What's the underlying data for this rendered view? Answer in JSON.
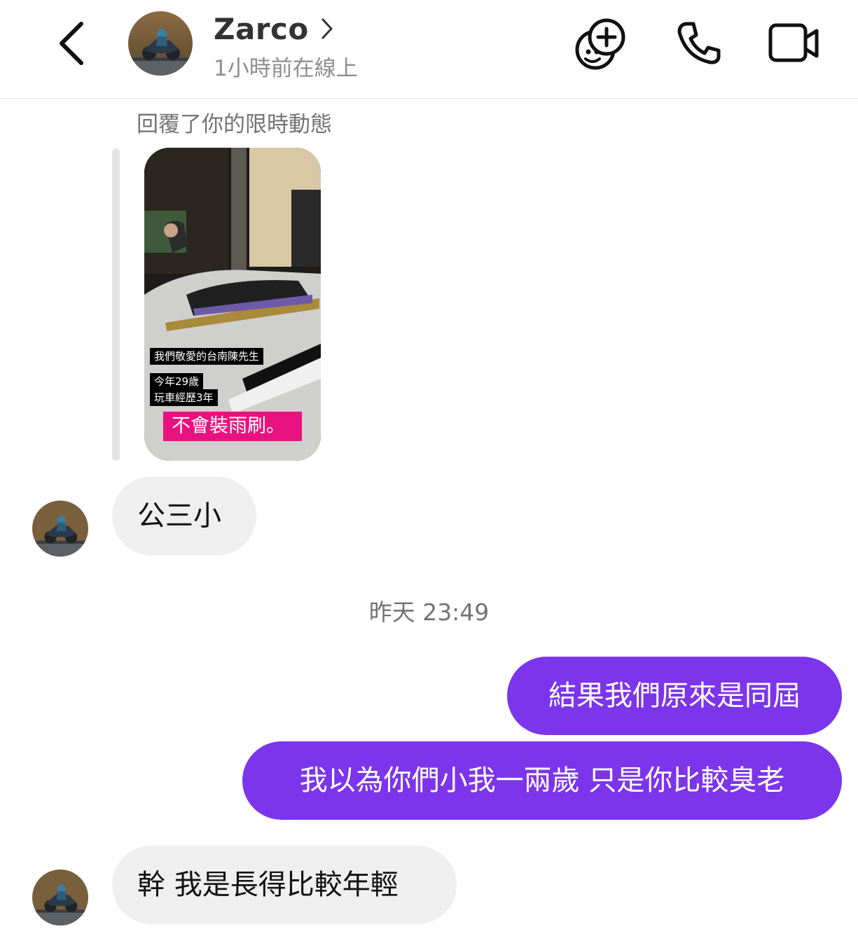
{
  "header": {
    "contact_name": "Zarco",
    "status": "1小時前在線上",
    "icons": [
      "back-chevron-icon",
      "chevron-right-icon",
      "game-controller-icon",
      "phone-icon",
      "video-camera-icon"
    ]
  },
  "conversation": {
    "reply_label": "回覆了你的限時動態",
    "story": {
      "caption_1": "我們敬愛的台南陳先生",
      "caption_2": "今年29歲",
      "caption_3": "玩車經歷3年",
      "caption_highlight": "不會裝雨刷。"
    },
    "messages": [
      {
        "from": "contact",
        "text": "公三小"
      },
      {
        "type": "timestamp",
        "text": "昨天 23:49"
      },
      {
        "from": "me",
        "text": "結果我們原來是同屆"
      },
      {
        "from": "me",
        "text": "我以為你們小我一兩歲 只是你比較臭老"
      },
      {
        "from": "contact",
        "text": "幹 我是長得比較年輕"
      }
    ]
  },
  "colors": {
    "outgoing_bubble": "#7c35ea",
    "incoming_bubble": "#efefef",
    "story_highlight": "#e8127e"
  }
}
